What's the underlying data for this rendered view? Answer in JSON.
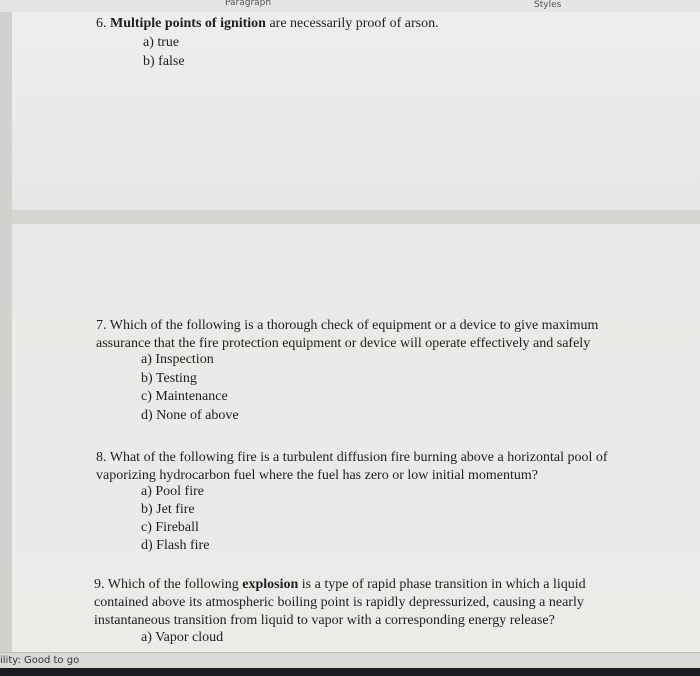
{
  "ribbon": {
    "paragraph_label": "Paragraph",
    "styles_label": "Styles"
  },
  "questions": [
    {
      "number": "6.",
      "bold": "Multiple points of ignition",
      "text": " are necessarily proof of arson.",
      "options": [
        "a) true",
        "b) false"
      ]
    },
    {
      "number": "7.",
      "line1": "Which of the following is a thorough check of equipment or a device to give maximum",
      "line2": "assurance that the fire protection equipment or device will operate effectively and safely",
      "options": [
        "a) Inspection",
        "b) Testing",
        "c) Maintenance",
        "d) None of above"
      ]
    },
    {
      "number": "8.",
      "line1": "What of the following fire is a turbulent diffusion fire burning above a horizontal pool of",
      "line2": "vaporizing hydrocarbon fuel where the fuel has zero or low initial momentum?",
      "options": [
        "a) Pool fire",
        "b) Jet fire",
        "c) Fireball",
        "d) Flash fire"
      ]
    },
    {
      "number": "9.",
      "pre": "Which of the following ",
      "bold": "explosion",
      "post": " is  a type of rapid phase transition in which a liquid",
      "line2": "contained above its atmospheric boiling point is rapidly depressurized, causing a nearly",
      "line3": "instantaneous transition from liquid to vapor with a corresponding energy release?",
      "options": [
        "a) Vapor cloud"
      ]
    }
  ],
  "status_bar": {
    "accessibility": "ility: Good to go"
  }
}
